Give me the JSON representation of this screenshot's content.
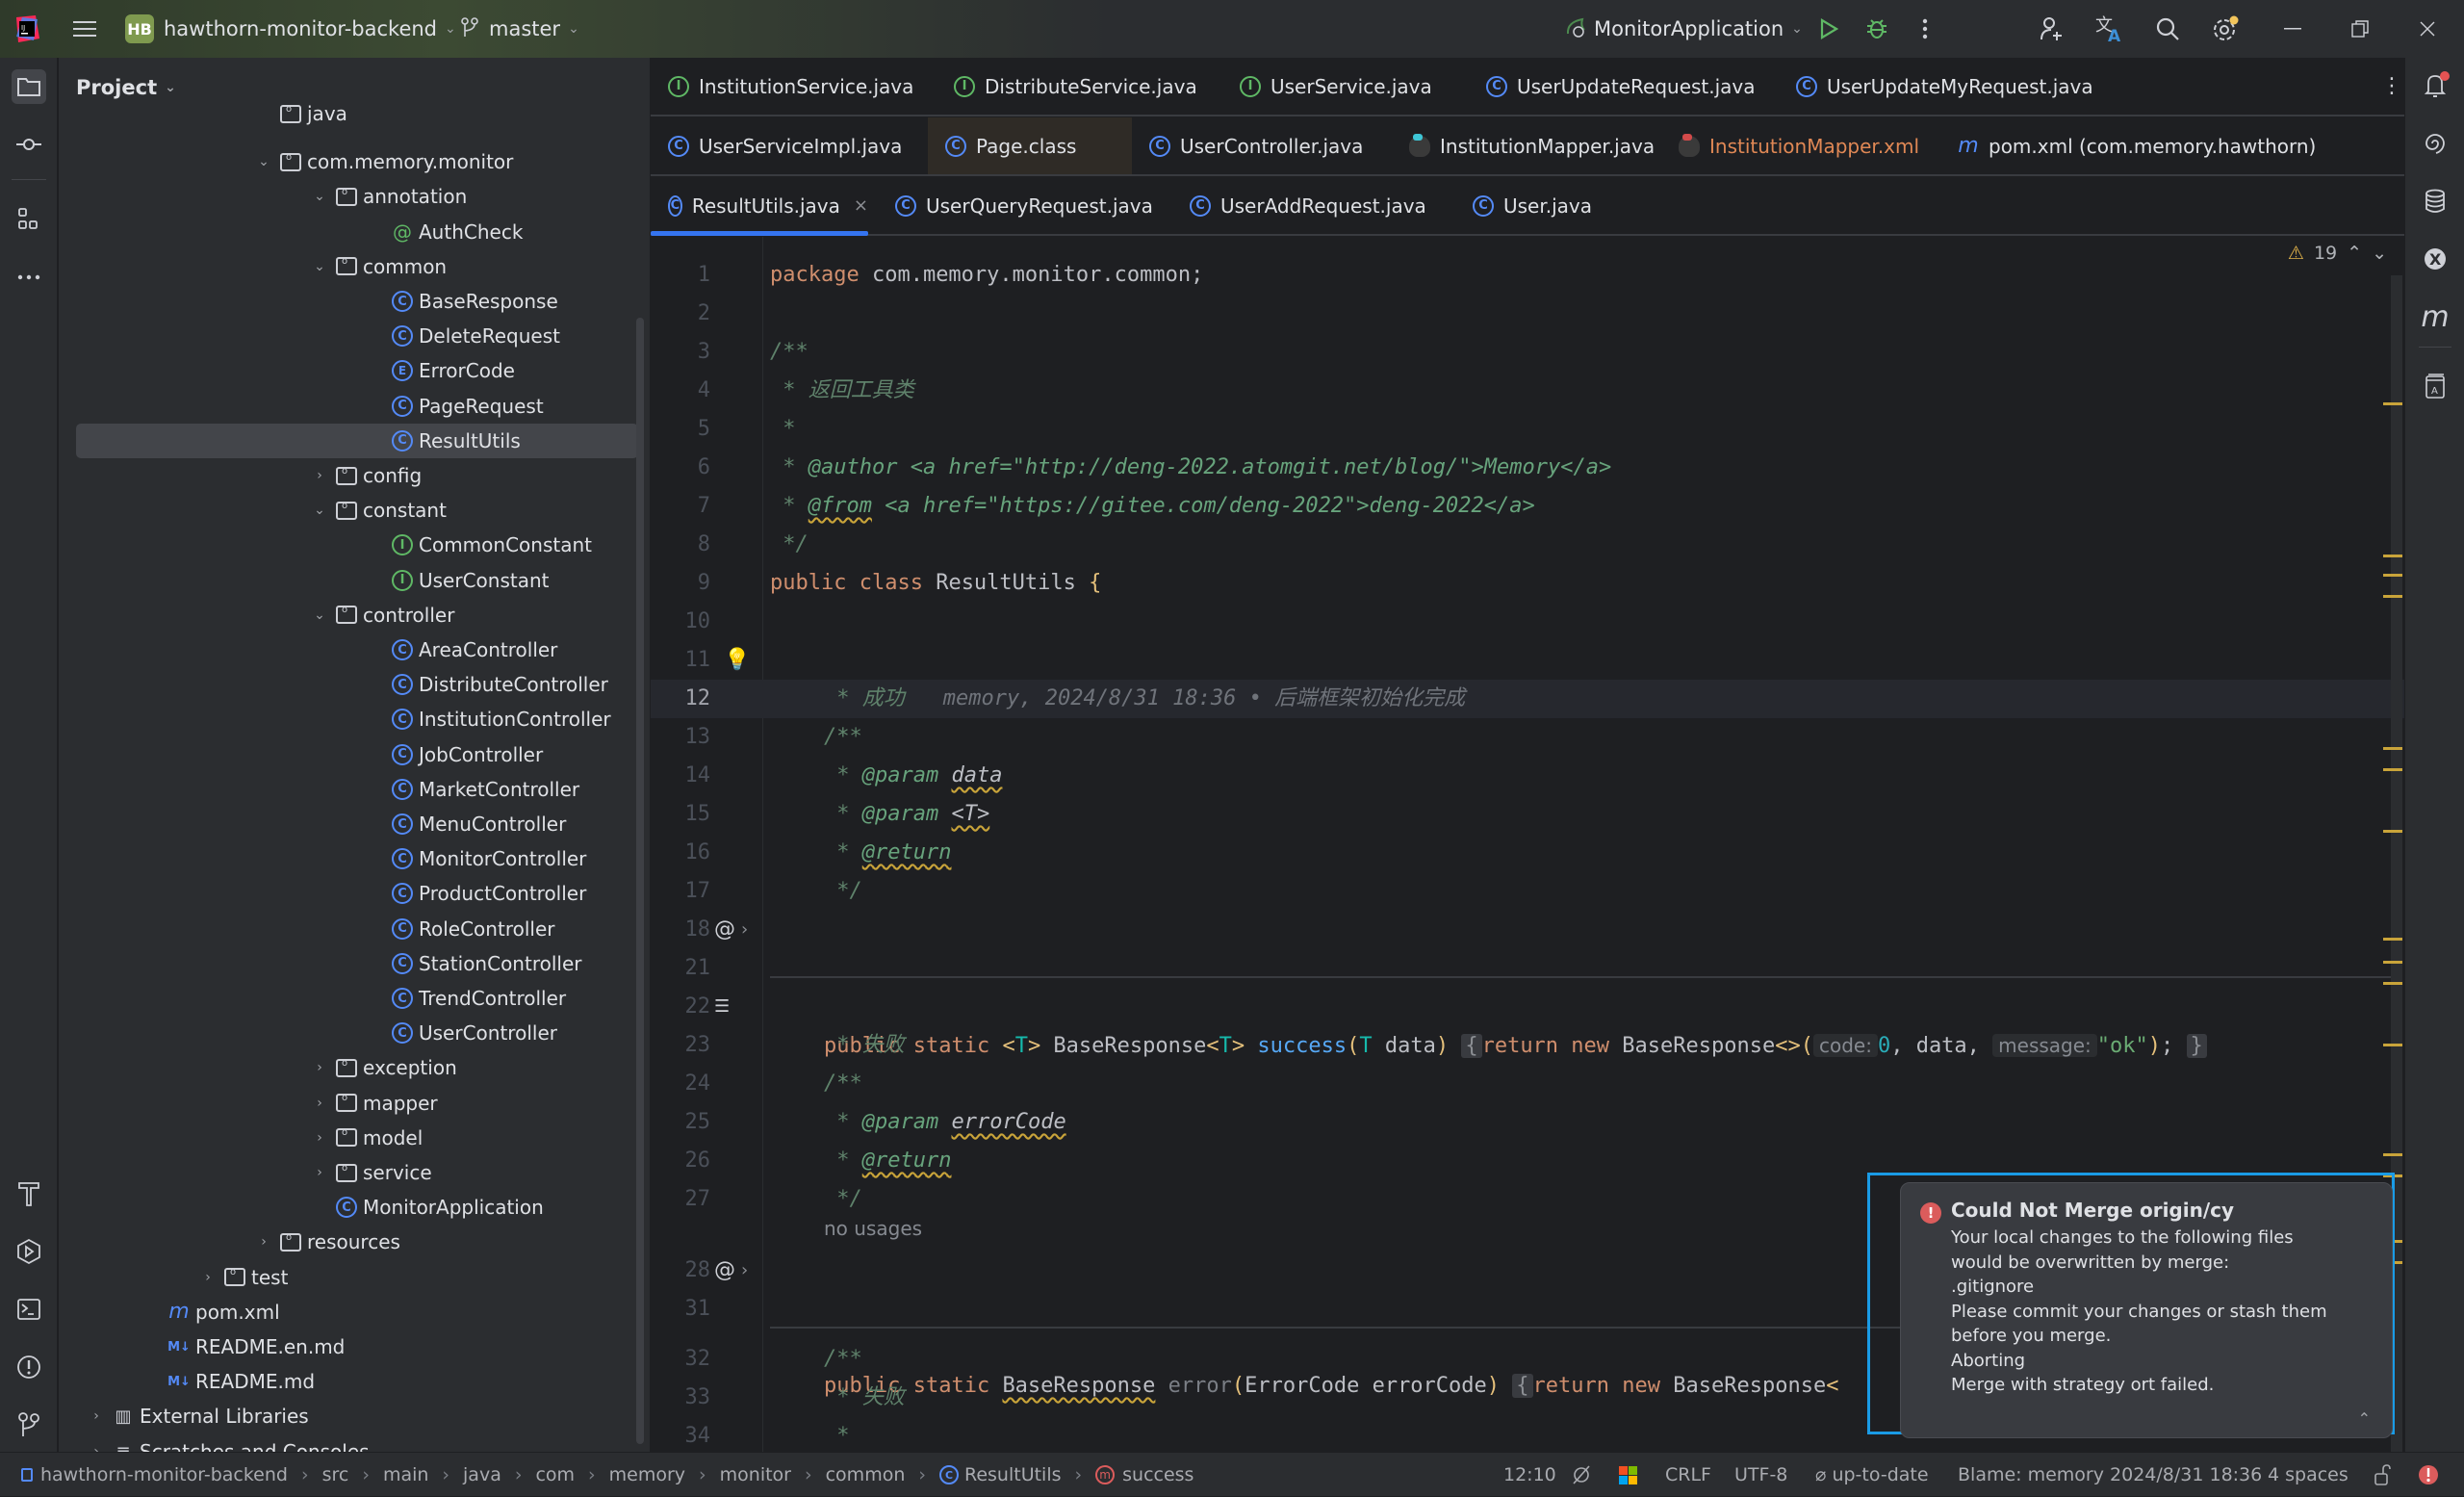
{
  "titlebar": {
    "project_badge": "HB",
    "project_name": "hawthorn-monitor-backend",
    "branch": "master",
    "run_config": "MonitorApplication",
    "icons": [
      "app-logo-icon",
      "main-menu-icon",
      "branch-icon",
      "run-config-icon",
      "run-icon",
      "debug-icon",
      "more-icon",
      "add-user-icon",
      "translate-icon",
      "search-icon",
      "settings-icon",
      "minimize-icon",
      "restore-icon",
      "close-icon"
    ]
  },
  "left_strip": {
    "icons": [
      "project-icon",
      "commit-icon",
      "structure-icon",
      "more-tools-icon",
      "build-icon",
      "services-icon",
      "terminal-icon",
      "problems-icon",
      "git-icon"
    ]
  },
  "project_panel": {
    "title": "Project",
    "tree": [
      {
        "label": "java",
        "type": "folder-partial",
        "depth": 3
      },
      {
        "label": "com.memory.monitor",
        "type": "package",
        "depth": 3,
        "expanded": true
      },
      {
        "label": "annotation",
        "type": "package",
        "depth": 4,
        "expanded": true
      },
      {
        "label": "AuthCheck",
        "type": "annotation",
        "depth": 5
      },
      {
        "label": "common",
        "type": "package",
        "depth": 4,
        "expanded": true
      },
      {
        "label": "BaseResponse",
        "type": "class",
        "depth": 5
      },
      {
        "label": "DeleteRequest",
        "type": "class",
        "depth": 5
      },
      {
        "label": "ErrorCode",
        "type": "enum",
        "depth": 5
      },
      {
        "label": "PageRequest",
        "type": "class",
        "depth": 5
      },
      {
        "label": "ResultUtils",
        "type": "class",
        "depth": 5,
        "selected": true
      },
      {
        "label": "config",
        "type": "package",
        "depth": 4,
        "expanded": false
      },
      {
        "label": "constant",
        "type": "package",
        "depth": 4,
        "expanded": true
      },
      {
        "label": "CommonConstant",
        "type": "interface",
        "depth": 5
      },
      {
        "label": "UserConstant",
        "type": "interface",
        "depth": 5
      },
      {
        "label": "controller",
        "type": "package",
        "depth": 4,
        "expanded": true
      },
      {
        "label": "AreaController",
        "type": "class",
        "depth": 5
      },
      {
        "label": "DistributeController",
        "type": "class",
        "depth": 5
      },
      {
        "label": "InstitutionController",
        "type": "class",
        "depth": 5
      },
      {
        "label": "JobController",
        "type": "class",
        "depth": 5
      },
      {
        "label": "MarketController",
        "type": "class",
        "depth": 5
      },
      {
        "label": "MenuController",
        "type": "class",
        "depth": 5
      },
      {
        "label": "MonitorController",
        "type": "class",
        "depth": 5
      },
      {
        "label": "ProductController",
        "type": "class",
        "depth": 5
      },
      {
        "label": "RoleController",
        "type": "class",
        "depth": 5
      },
      {
        "label": "StationController",
        "type": "class",
        "depth": 5
      },
      {
        "label": "TrendController",
        "type": "class",
        "depth": 5
      },
      {
        "label": "UserController",
        "type": "class",
        "depth": 5
      },
      {
        "label": "exception",
        "type": "package",
        "depth": 4,
        "expanded": false
      },
      {
        "label": "mapper",
        "type": "package",
        "depth": 4,
        "expanded": false
      },
      {
        "label": "model",
        "type": "package",
        "depth": 4,
        "expanded": false
      },
      {
        "label": "service",
        "type": "package",
        "depth": 4,
        "expanded": false
      },
      {
        "label": "MonitorApplication",
        "type": "spring-class",
        "depth": 4
      },
      {
        "label": "resources",
        "type": "resources",
        "depth": 3,
        "expanded": false
      },
      {
        "label": "test",
        "type": "folder",
        "depth": 2,
        "expanded": false
      },
      {
        "label": "pom.xml",
        "type": "maven",
        "depth": 1
      },
      {
        "label": "README.en.md",
        "type": "markdown",
        "depth": 1
      },
      {
        "label": "README.md",
        "type": "markdown",
        "depth": 1
      },
      {
        "label": "External Libraries",
        "type": "libraries",
        "depth": 0,
        "expanded": false
      },
      {
        "label": "Scratches and Consoles",
        "type": "scratches",
        "depth": 0,
        "expanded": false
      }
    ]
  },
  "tabs": {
    "rows": [
      [
        {
          "label": "InstitutionService.java",
          "icon": "interface"
        },
        {
          "label": "DistributeService.java",
          "icon": "interface"
        },
        {
          "label": "UserService.java",
          "icon": "interface"
        },
        {
          "label": "UserUpdateRequest.java",
          "icon": "class"
        },
        {
          "label": "UserUpdateMyRequest.java",
          "icon": "class"
        }
      ],
      [
        {
          "label": "UserServiceImpl.java",
          "icon": "class"
        },
        {
          "label": "Page.class",
          "icon": "class",
          "highlighted": true
        },
        {
          "label": "UserController.java",
          "icon": "class"
        },
        {
          "label": "InstitutionMapper.java",
          "icon": "mybatis-java"
        },
        {
          "label": "InstitutionMapper.xml",
          "icon": "mybatis-xml",
          "modified_color": "#e08855"
        },
        {
          "label": "pom.xml (com.memory.hawthorn)",
          "icon": "maven"
        }
      ],
      [
        {
          "label": "ResultUtils.java",
          "icon": "class",
          "active": true,
          "closable": true
        },
        {
          "label": "UserQueryRequest.java",
          "icon": "class"
        },
        {
          "label": "UserAddRequest.java",
          "icon": "class"
        },
        {
          "label": "User.java",
          "icon": "class"
        }
      ]
    ],
    "more_label": "⋮",
    "close_glyph": "×"
  },
  "editor": {
    "warning_count": "19",
    "current_line": 12,
    "lines": {
      "l1": {
        "n": "1",
        "kw": "package",
        "rest": " com.memory.monitor.common;"
      },
      "l2": {
        "n": "2"
      },
      "l3": {
        "n": "3",
        "text": "/**"
      },
      "l4": {
        "n": "4",
        "text": " * 返回工具类"
      },
      "l5": {
        "n": "5",
        "text": " *"
      },
      "l6": {
        "n": "6",
        "star": " * ",
        "tag": "@author",
        "rest": " <a href=\"http://deng-2022.atomgit.net/blog/\">Memory</a>"
      },
      "l7": {
        "n": "7",
        "star": " * ",
        "tag": "@from",
        "rest": " <a href=\"https://gitee.com/deng-2022\">deng-2022</a>"
      },
      "l8": {
        "n": "8",
        "text": " */"
      },
      "l9": {
        "n": "9",
        "kw": "public class",
        "name": " ResultUtils ",
        "brace": "{"
      },
      "l10": {
        "n": "10"
      },
      "l11": {
        "n": "11",
        "text": "/**"
      },
      "l12": {
        "n": "12",
        "text": " * 成功",
        "blame": "memory, 2024/8/31 18:36 • 后端框架初始化完成"
      },
      "l13": {
        "n": "13",
        "text": " *"
      },
      "l14": {
        "n": "14",
        "star": " * ",
        "tag": "@param",
        "arg": "data"
      },
      "l15": {
        "n": "15",
        "star": " * ",
        "tag": "@param",
        "arg": "<T>"
      },
      "l16": {
        "n": "16",
        "star": " * ",
        "tag": "@return"
      },
      "l17": {
        "n": "17",
        "text": " */"
      },
      "l18": {
        "n": "18",
        "kw1": "public static ",
        "lt": "<",
        "T": "T",
        "gt": ">",
        "type": " BaseResponse",
        "lt2": "<",
        "T2": "T",
        "gt2": ">",
        "fn": " success",
        "po": "(",
        "T3": "T",
        "arg": " data",
        "pc": ")",
        "fold_open": "{",
        "ret": "return new",
        "ctor": " BaseResponse",
        "diamond": "<>",
        "po2": "(",
        "hint1": "code:",
        "zero": "0",
        "mid": ", data, ",
        "hint2": "message:",
        "str": "\"ok\"",
        "pc2": ")",
        "semi": ";",
        "fold_close": "}"
      },
      "l21": {
        "n": "21"
      },
      "l22": {
        "n": "22",
        "text": "/**"
      },
      "l23": {
        "n": "23",
        "text": " * 失败"
      },
      "l24": {
        "n": "24",
        "text": " *"
      },
      "l25": {
        "n": "25",
        "star": " * ",
        "tag": "@param",
        "arg": "errorCode"
      },
      "l26": {
        "n": "26",
        "star": " * ",
        "tag": "@return"
      },
      "l27": {
        "n": "27",
        "text": " */"
      },
      "no_usages": "no usages",
      "l28": {
        "n": "28",
        "kw1": "public static ",
        "type": "BaseResponse",
        "fn": " error",
        "po": "(",
        "params": "ErrorCode errorCode",
        "pc": ")",
        "fold_open": "{",
        "ret": "return new",
        "ctor": " BaseResponse",
        "lt": "<"
      },
      "l31": {
        "n": "31"
      },
      "l32": {
        "n": "32",
        "text": "/**"
      },
      "l33": {
        "n": "33",
        "text": " * 失败"
      },
      "l34": {
        "n": "34",
        "text": " *"
      }
    }
  },
  "right_strip": {
    "icons": [
      "notifications-icon",
      "copilot-icon",
      "database-icon",
      "mybatis-icon",
      "maven-icon",
      "translation-book-icon"
    ],
    "m_glyph": "m"
  },
  "notification": {
    "title": "Could Not Merge origin/cy",
    "lines": [
      "Your local changes to the following files",
      "would be overwritten by merge:",
      ".gitignore",
      "Please commit your changes or stash them",
      "before you merge.",
      "Aborting",
      "Merge with strategy ort failed."
    ],
    "status_color": "#db5c5c"
  },
  "statusbar": {
    "breadcrumbs": [
      "hawthorn-monitor-backend",
      "src",
      "main",
      "java",
      "com",
      "memory",
      "monitor",
      "common",
      "ResultUtils",
      "success"
    ],
    "cursor": "12:10",
    "line_sep": "CRLF",
    "encoding": "UTF-8",
    "vcs": "up-to-date",
    "blame": "Blame: memory 2024/8/31 18:36",
    "indent": "4 spaces"
  }
}
